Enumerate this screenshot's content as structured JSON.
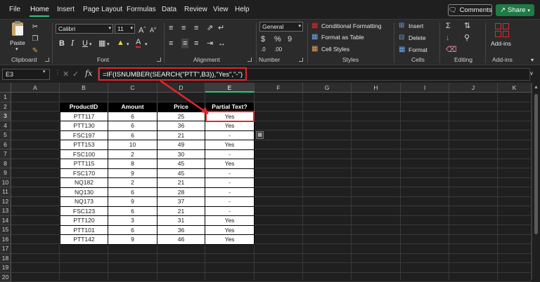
{
  "menu": {
    "tabs": [
      "File",
      "Home",
      "Insert",
      "Page Layout",
      "Formulas",
      "Data",
      "Review",
      "View",
      "Help"
    ],
    "comments_label": "Comments",
    "share_label": "Share"
  },
  "ribbon": {
    "clipboard": {
      "paste_label": "Paste",
      "group_label": "Clipboard"
    },
    "font": {
      "font_name": "Calibri",
      "font_size": "11",
      "group_label": "Font",
      "bold": "B",
      "italic": "I",
      "underline": "U",
      "grow": "A",
      "shrink": "A"
    },
    "alignment": {
      "group_label": "Alignment"
    },
    "number": {
      "format": "General",
      "group_label": "Number",
      "currency": "$",
      "percent": "%",
      "comma": "9"
    },
    "styles": {
      "conditional_formatting": "Conditional Formatting",
      "format_as_table": "Format as Table",
      "cell_styles": "Cell Styles",
      "group_label": "Styles"
    },
    "cells": {
      "insert": "Insert",
      "delete": "Delete",
      "format": "Format",
      "group_label": "Cells"
    },
    "editing": {
      "group_label": "Editing"
    },
    "addins": {
      "label": "Add-ins",
      "group_label": "Add-ins"
    }
  },
  "formula_bar": {
    "name_box": "E3",
    "formula": "=IF(ISNUMBER(SEARCH(\"PTT\",B3)),\"Yes\",\"-\")"
  },
  "columns": [
    "A",
    "B",
    "C",
    "D",
    "E",
    "F",
    "G",
    "H",
    "I",
    "J",
    "K"
  ],
  "selected_column": "E",
  "rows": [
    "1",
    "2",
    "3",
    "4",
    "5",
    "6",
    "7",
    "8",
    "9",
    "10",
    "11",
    "12",
    "13",
    "14",
    "15",
    "16",
    "17",
    "18",
    "19",
    "20"
  ],
  "selected_row": "3",
  "table": {
    "headers": [
      "ProductID",
      "Amount",
      "Price",
      "Partial Text?"
    ],
    "rows": [
      [
        "PTT117",
        "6",
        "25",
        "Yes"
      ],
      [
        "PTT130",
        "6",
        "36",
        "Yes"
      ],
      [
        "FSC197",
        "6",
        "21",
        "-"
      ],
      [
        "PTT153",
        "10",
        "49",
        "Yes"
      ],
      [
        "FSC100",
        "2",
        "30",
        "-"
      ],
      [
        "PTT115",
        "8",
        "45",
        "Yes"
      ],
      [
        "FSC170",
        "9",
        "45",
        "-"
      ],
      [
        "NQ182",
        "2",
        "21",
        "-"
      ],
      [
        "NQ130",
        "6",
        "28",
        "-"
      ],
      [
        "NQ173",
        "9",
        "37",
        "-"
      ],
      [
        "FSC123",
        "6",
        "21",
        "-"
      ],
      [
        "PTT120",
        "3",
        "31",
        "Yes"
      ],
      [
        "PTT101",
        "6",
        "36",
        "Yes"
      ],
      [
        "PTT142",
        "9",
        "46",
        "Yes"
      ]
    ]
  },
  "colors": {
    "accent": "#33c481",
    "highlight": "#e3262c",
    "share": "#1f7a45"
  }
}
